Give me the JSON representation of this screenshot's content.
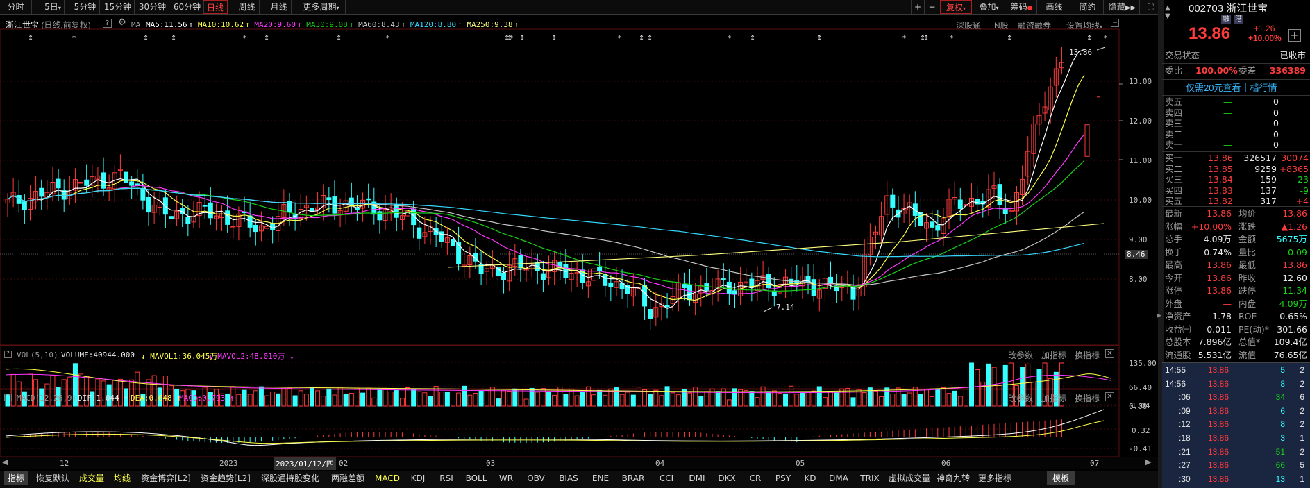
{
  "toolbar": {
    "periods": [
      {
        "label": "分时"
      },
      {
        "label": "5日"
      },
      {
        "label": "5分钟"
      },
      {
        "label": "15分钟"
      },
      {
        "label": "30分钟"
      },
      {
        "label": "60分钟"
      },
      {
        "label": "日线",
        "active": true
      },
      {
        "label": "周线"
      },
      {
        "label": "月线"
      },
      {
        "label": "更多周期"
      }
    ],
    "right": [
      "+",
      "−",
      "复权",
      "叠加",
      "筹码",
      "画线",
      "简约",
      "隐藏"
    ]
  },
  "chart_header": {
    "name": "浙江世宝",
    "period": "(日线,前复权)",
    "ma_label": "MA",
    "ma": [
      {
        "label": "MA5:11.56",
        "color": "#ffffff"
      },
      {
        "label": "MA10:10.62",
        "color": "#ffff4a"
      },
      {
        "label": "MA20:9.60",
        "color": "#ff38ff"
      },
      {
        "label": "MA30:9.08",
        "color": "#18d218"
      },
      {
        "label": "MA60:8.43",
        "color": "#c8c8c8"
      },
      {
        "label": "MA120:8.80",
        "color": "#36d8ff"
      },
      {
        "label": "MA250:9.38",
        "color": "#ffff80"
      }
    ],
    "links": [
      "深股通",
      "N股",
      "融资融券",
      "设置均线"
    ]
  },
  "price_axis": [
    "13.00",
    "12.00",
    "11.00",
    "10.00",
    "9.00",
    "8.46",
    "8.00"
  ],
  "annotations": {
    "high": "13.86",
    "low": "7.14"
  },
  "vol_header": {
    "label": "VOL(5,10)",
    "volume": "VOLUME:40944.000",
    "m1": "MAVOL1:36.045万",
    "m2": "MAVOL2:48.010万",
    "btns": [
      "改参数",
      "加指标",
      "换指标"
    ]
  },
  "vol_axis": [
    "135.00",
    "66.40",
    "0.00"
  ],
  "macd_header": {
    "label": "MACD(12,26,9)",
    "dif": "DIF:1.044",
    "dea": "DEA:0.648",
    "macd": "MACD:0.793",
    "btns": [
      "改参数",
      "加指标",
      "换指标"
    ]
  },
  "macd_axis": [
    "1.04",
    "0.32",
    "-0.41"
  ],
  "date_axis": [
    {
      "t": "12"
    },
    {
      "t": "2023"
    },
    {
      "t": "2023/01/12/四",
      "hl": true
    },
    {
      "t": "02"
    },
    {
      "t": "03"
    },
    {
      "t": "04"
    },
    {
      "t": "05"
    },
    {
      "t": "06"
    },
    {
      "t": "07"
    }
  ],
  "bottom_tabs": [
    {
      "t": "指标",
      "active": true
    },
    {
      "t": "恢复默认"
    },
    {
      "t": "成交量",
      "c": "#ffff4a"
    },
    {
      "t": "均线",
      "c": "#ffff4a"
    },
    {
      "t": "资金博弈[L2]"
    },
    {
      "t": "资金趋势[L2]"
    },
    {
      "t": "深股通持股变化"
    },
    {
      "t": "两融差额"
    },
    {
      "t": "MACD",
      "c": "#ffff4a"
    },
    {
      "t": "KDJ"
    },
    {
      "t": "RSI"
    },
    {
      "t": "BOLL"
    },
    {
      "t": "WR"
    },
    {
      "t": "OBV"
    },
    {
      "t": "BIAS"
    },
    {
      "t": "ENE"
    },
    {
      "t": "BRAR"
    },
    {
      "t": "CCI"
    },
    {
      "t": "DMI"
    },
    {
      "t": "DKX"
    },
    {
      "t": "CR"
    },
    {
      "t": "PSY"
    },
    {
      "t": "KD"
    },
    {
      "t": "DMA"
    },
    {
      "t": "TRIX"
    },
    {
      "t": "虚拟成交量"
    },
    {
      "t": "神奇九转"
    },
    {
      "t": "更多指标"
    },
    {
      "t": "模板",
      "active": true
    }
  ],
  "quote": {
    "code": "002703",
    "name": "浙江世宝",
    "tags": [
      "融",
      "港"
    ],
    "price": "13.86",
    "change": "+1.26",
    "pct": "+10.00%",
    "status_label": "交易状态",
    "status": "已收市",
    "weibi_label": "委比",
    "weibi": "100.00%",
    "weicha_label": "委差",
    "weicha": "336389",
    "promo": "仅需20元查看十档行情",
    "sells": [
      {
        "l": "卖五",
        "p": "—",
        "v": "0"
      },
      {
        "l": "卖四",
        "p": "—",
        "v": "0"
      },
      {
        "l": "卖三",
        "p": "—",
        "v": "0"
      },
      {
        "l": "卖二",
        "p": "—",
        "v": "0"
      },
      {
        "l": "卖一",
        "p": "—",
        "v": "0"
      }
    ],
    "buys": [
      {
        "l": "买一",
        "p": "13.86",
        "v": "326517",
        "d": "30074"
      },
      {
        "l": "买二",
        "p": "13.85",
        "v": "9259",
        "d": "+8365"
      },
      {
        "l": "买三",
        "p": "13.84",
        "v": "159",
        "d": "-23"
      },
      {
        "l": "买四",
        "p": "13.83",
        "v": "137",
        "d": "-9"
      },
      {
        "l": "买五",
        "p": "13.82",
        "v": "317",
        "d": "+4"
      }
    ],
    "stats": [
      {
        "l1": "最新",
        "v1": "13.86",
        "c1": "#ff3b3b",
        "l2": "均价",
        "v2": "13.86",
        "c2": "#ff3b3b"
      },
      {
        "l1": "涨幅",
        "v1": "+10.00%",
        "c1": "#ff3b3b",
        "l2": "涨跌",
        "v2": "▲1.26",
        "c2": "#ff3b3b"
      },
      {
        "l1": "总手",
        "v1": "4.09万",
        "c1": "#e8e8e8",
        "l2": "金额",
        "v2": "5675万",
        "c2": "#36ffff"
      },
      {
        "l1": "换手",
        "v1": "0.74%",
        "c1": "#e8e8e8",
        "l2": "量比",
        "v2": "0.09",
        "c2": "#18d218"
      },
      {
        "l1": "最高",
        "v1": "13.86",
        "c1": "#ff3b3b",
        "l2": "最低",
        "v2": "13.86",
        "c2": "#ff3b3b"
      },
      {
        "l1": "今开",
        "v1": "13.86",
        "c1": "#ff3b3b",
        "l2": "昨收",
        "v2": "12.60",
        "c2": "#e8e8e8"
      },
      {
        "l1": "涨停",
        "v1": "13.86",
        "c1": "#ff3b3b",
        "l2": "跌停",
        "v2": "11.34",
        "c2": "#18d218"
      },
      {
        "l1": "外盘",
        "v1": "—",
        "c1": "#ff3b3b",
        "l2": "内盘",
        "v2": "4.09万",
        "c2": "#18d218"
      },
      {
        "l1": "净资产",
        "v1": "1.78",
        "c1": "#e8e8e8",
        "l2": "ROE",
        "v2": "0.65%",
        "c2": "#e8e8e8"
      },
      {
        "l1": "收益㈠",
        "v1": "0.011",
        "c1": "#e8e8e8",
        "l2": "PE(动)*",
        "v2": "301.66",
        "c2": "#e8e8e8"
      },
      {
        "l1": "总股本",
        "v1": "7.896亿",
        "c1": "#e8e8e8",
        "l2": "总值*",
        "v2": "109.4亿",
        "c2": "#e8e8e8"
      },
      {
        "l1": "流通股",
        "v1": "5.531亿",
        "c1": "#e8e8e8",
        "l2": "流值",
        "v2": "76.65亿",
        "c2": "#e8e8e8"
      }
    ],
    "ticks": [
      {
        "t": "14:55",
        "p": "13.86",
        "v": "5",
        "n": "2"
      },
      {
        "t": "14:56",
        "p": "13.86",
        "v": "8",
        "n": "2"
      },
      {
        "t": ":06",
        "p": "13.86",
        "v": "34",
        "n": "6"
      },
      {
        "t": ":09",
        "p": "13.86",
        "v": "6",
        "n": "2"
      },
      {
        "t": ":12",
        "p": "13.86",
        "v": "8",
        "n": "2"
      },
      {
        "t": ":18",
        "p": "13.86",
        "v": "3",
        "n": "1"
      },
      {
        "t": ":21",
        "p": "13.86",
        "v": "51",
        "n": "2"
      },
      {
        "t": ":27",
        "p": "13.86",
        "v": "66",
        "n": "5"
      },
      {
        "t": ":30",
        "p": "13.86",
        "v": "13",
        "n": "1"
      }
    ]
  },
  "colors": {
    "up": "#ff3b3b",
    "down": "#36ffff",
    "bg": "#000000",
    "grid": "#3a0d0d"
  }
}
